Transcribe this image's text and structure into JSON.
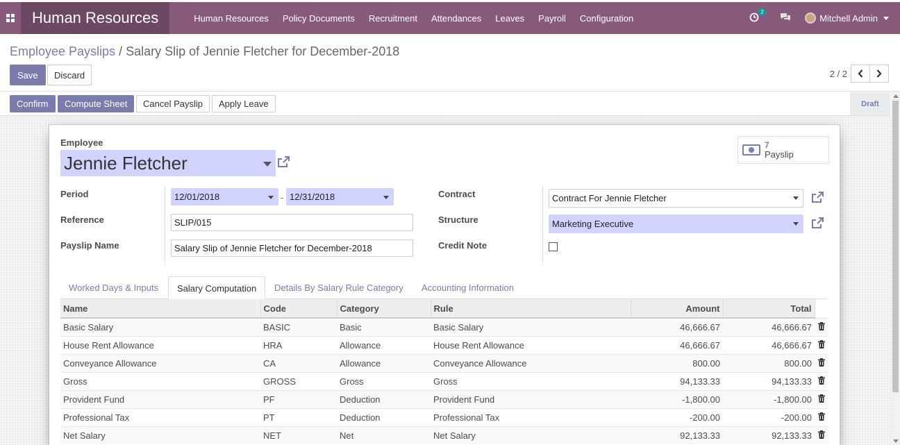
{
  "navbar": {
    "brand": "Human Resources",
    "menu": [
      "Human Resources",
      "Policy Documents",
      "Recruitment",
      "Attendances",
      "Leaves",
      "Payroll",
      "Configuration"
    ],
    "activity_count": "2",
    "user_name": "Mitchell Admin"
  },
  "breadcrumb": {
    "parent": "Employee Payslips",
    "separator": "/",
    "current": "Salary Slip of Jennie Fletcher for December-2018"
  },
  "buttons": {
    "save": "Save",
    "discard": "Discard"
  },
  "pager": {
    "value": "2 / 2"
  },
  "statusbar": {
    "confirm": "Confirm",
    "compute": "Compute Sheet",
    "cancel": "Cancel Payslip",
    "apply_leave": "Apply Leave",
    "state": "Draft"
  },
  "form": {
    "employee_label": "Employee",
    "employee": "Jennie Fletcher",
    "stat_count": "7",
    "stat_label": "Payslip",
    "period_label": "Period",
    "date_from": "12/01/2018",
    "date_sep": "-",
    "date_to": "12/31/2018",
    "reference_label": "Reference",
    "reference": "SLIP/015",
    "payslip_name_label": "Payslip Name",
    "payslip_name": "Salary Slip of Jennie Fletcher for December-2018",
    "contract_label": "Contract",
    "contract": "Contract For Jennie Fletcher",
    "structure_label": "Structure",
    "structure": "Marketing Executive",
    "credit_note_label": "Credit Note"
  },
  "tabs": [
    "Worked Days & Inputs",
    "Salary Computation",
    "Details By Salary Rule Category",
    "Accounting Information"
  ],
  "table": {
    "headers": [
      "Name",
      "Code",
      "Category",
      "Rule",
      "Amount",
      "Total"
    ],
    "rows": [
      [
        "Basic Salary",
        "BASIC",
        "Basic",
        "Basic Salary",
        "46,666.67",
        "46,666.67"
      ],
      [
        "House Rent Allowance",
        "HRA",
        "Allowance",
        "House Rent Allowance",
        "46,666.67",
        "46,666.67"
      ],
      [
        "Conveyance Allowance",
        "CA",
        "Allowance",
        "Conveyance Allowance",
        "800.00",
        "800.00"
      ],
      [
        "Gross",
        "GROSS",
        "Gross",
        "Gross",
        "94,133.33",
        "94,133.33"
      ],
      [
        "Provident Fund",
        "PF",
        "Deduction",
        "Provident Fund",
        "-1,800.00",
        "-1,800.00"
      ],
      [
        "Professional Tax",
        "PT",
        "Deduction",
        "Professional Tax",
        "-200.00",
        "-200.00"
      ],
      [
        "Net Salary",
        "NET",
        "Net",
        "Net Salary",
        "92,133.33",
        "92,133.33"
      ]
    ]
  },
  "colors": {
    "navbar": "#875a7b",
    "brand_bg": "#6d4862",
    "primary": "#7c7bad",
    "required_field": "#d2d2ff"
  }
}
